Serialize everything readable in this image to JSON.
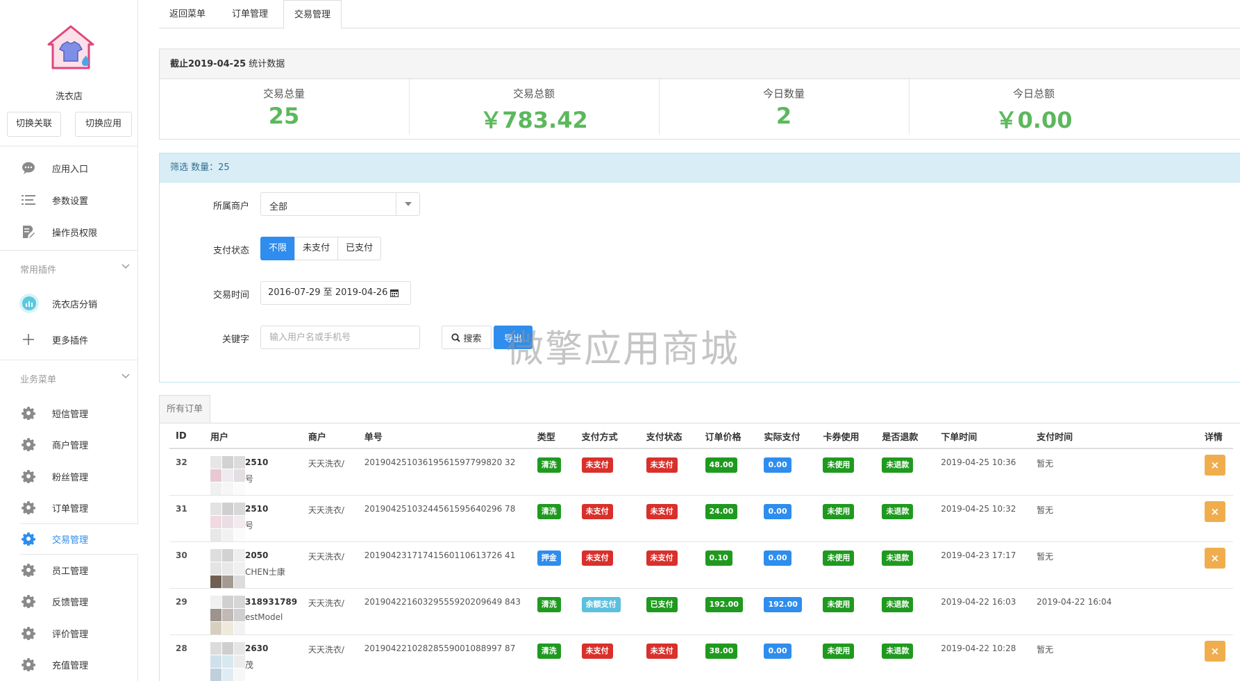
{
  "sidebar": {
    "shop_name": "洗衣店",
    "switch_link": "切换关联",
    "switch_app": "切换应用",
    "top_items": [
      {
        "label": "应用入口",
        "icon": "chat-bubble-icon"
      },
      {
        "label": "参数设置",
        "icon": "list-icon"
      },
      {
        "label": "操作员权限",
        "icon": "edit-document-icon"
      }
    ],
    "plugins_title": "常用插件",
    "plugins": [
      {
        "label": "洗衣店分销",
        "icon": "distribution-icon"
      },
      {
        "label": "更多插件",
        "icon": "plus-icon"
      }
    ],
    "business_title": "业务菜单",
    "business": [
      {
        "label": "短信管理",
        "icon": "gear-icon"
      },
      {
        "label": "商户管理",
        "icon": "gear-icon"
      },
      {
        "label": "粉丝管理",
        "icon": "gear-icon"
      },
      {
        "label": "订单管理",
        "icon": "gear-icon"
      },
      {
        "label": "交易管理",
        "icon": "gear-icon",
        "active": true
      },
      {
        "label": "员工管理",
        "icon": "gear-icon"
      },
      {
        "label": "反馈管理",
        "icon": "gear-icon"
      },
      {
        "label": "评价管理",
        "icon": "gear-icon"
      },
      {
        "label": "充值管理",
        "icon": "gear-icon"
      }
    ]
  },
  "tabs": [
    "返回菜单",
    "订单管理",
    "交易管理"
  ],
  "stats": {
    "heading_bold": "截止2019-04-25",
    "heading_rest": " 统计数据",
    "items": [
      {
        "label": "交易总量",
        "value": "25"
      },
      {
        "label": "交易总额",
        "value": "￥783.42"
      },
      {
        "label": "今日数量",
        "value": "2"
      },
      {
        "label": "今日总额",
        "value": "￥0.00"
      }
    ]
  },
  "filter": {
    "heading": "筛选 数量：25",
    "merchant_label": "所属商户",
    "merchant_value": "全部",
    "pay_status_label": "支付状态",
    "pay_status_options": [
      "不限",
      "未支付",
      "已支付"
    ],
    "time_label": "交易时间",
    "time_value": "2016-07-29 至 2019-04-26",
    "keyword_label": "关键字",
    "keyword_placeholder": "输入用户名或手机号",
    "search_label": "搜索",
    "export_label": "导出"
  },
  "watermark": "微擎应用商城",
  "orders": {
    "tab_label": "所有订单",
    "columns": [
      "ID",
      "用户",
      "商户",
      "单号",
      "类型",
      "支付方式",
      "支付状态",
      "订单价格",
      "实际支付",
      "卡券使用",
      "是否退款",
      "下单时间",
      "支付时间",
      "详情"
    ],
    "rows": [
      {
        "id": "32",
        "user1": "2510",
        "user2": "号",
        "merchant": "天天洗衣/",
        "no": "20190425103619561597799820 32",
        "type": "清洗",
        "pay_method": "未支付",
        "pay_status": "未支付",
        "price": "48.00",
        "paid": "0.00",
        "coupon": "未使用",
        "refund": "未退款",
        "order_time": "2019-04-25 10:36",
        "pay_time": "暂无",
        "detail": true
      },
      {
        "id": "31",
        "user1": "2510",
        "user2": "号",
        "merchant": "天天洗衣/",
        "no": "20190425103244561595640296 78",
        "type": "清洗",
        "pay_method": "未支付",
        "pay_status": "未支付",
        "price": "24.00",
        "paid": "0.00",
        "coupon": "未使用",
        "refund": "未退款",
        "order_time": "2019-04-25 10:32",
        "pay_time": "暂无",
        "detail": true
      },
      {
        "id": "30",
        "user1": "2050",
        "user2": "CHEN士康",
        "merchant": "天天洗衣/",
        "no": "20190423171741560110613726 41",
        "type": "押金",
        "pay_method": "未支付",
        "pay_status": "未支付",
        "price": "0.10",
        "paid": "0.00",
        "coupon": "未使用",
        "refund": "未退款",
        "order_time": "2019-04-23 17:17",
        "pay_time": "暂无",
        "detail": true
      },
      {
        "id": "29",
        "user1": "318931789",
        "user2": "estModel",
        "merchant": "天天洗衣/",
        "no": "20190422160329555920209649 843",
        "type": "清洗",
        "pay_method": "余额支付",
        "pay_status": "已支付",
        "price": "192.00",
        "paid": "192.00",
        "coupon": "未使用",
        "refund": "未退款",
        "order_time": "2019-04-22 16:03",
        "pay_time": "2019-04-22 16:04",
        "detail": false
      },
      {
        "id": "28",
        "user1": "2630",
        "user2": "茂",
        "merchant": "天天洗衣/",
        "no": "20190422102828559001088997 87",
        "type": "清洗",
        "pay_method": "未支付",
        "pay_status": "未支付",
        "price": "38.00",
        "paid": "0.00",
        "coupon": "未使用",
        "refund": "未退款",
        "order_time": "2019-04-22 10:28",
        "pay_time": "暂无",
        "detail": true
      }
    ]
  },
  "colors": {
    "primary": "#2e8ded",
    "green": "#5cb85c",
    "label_green": "#1f9a1f",
    "label_red": "#d9302c",
    "label_blue": "#2e8ded",
    "label_cyan": "#5bc0de",
    "warning": "#f0ad4e"
  }
}
